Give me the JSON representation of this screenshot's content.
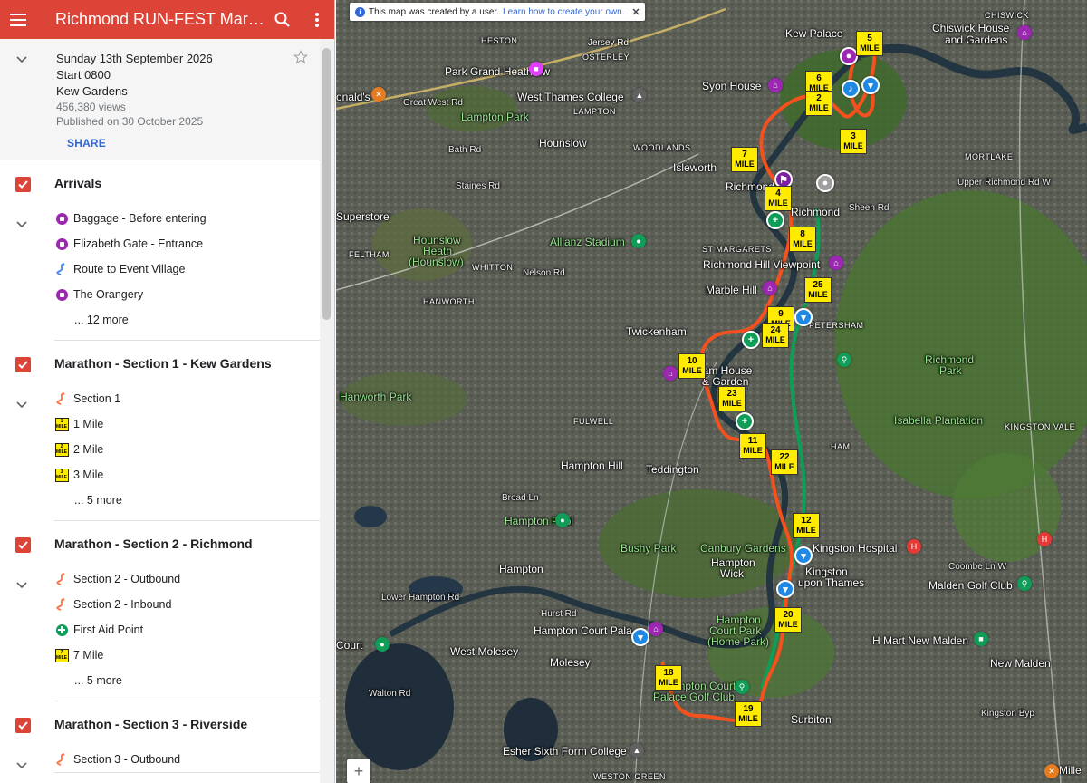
{
  "header": {
    "title": "Richmond RUN-FEST Marathon"
  },
  "info": {
    "date": "Sunday 13th September 2026",
    "start": "Start 0800",
    "venue": "Kew Gardens",
    "views": "456,380 views",
    "published": "Published on 30 October 2025",
    "share_label": "SHARE"
  },
  "layers": [
    {
      "title": "Arrivals",
      "items": [
        {
          "label": "Baggage - Before entering",
          "icon": "baggage-icon",
          "color": "#9c27b0"
        },
        {
          "label": "Elizabeth Gate - Entrance",
          "icon": "entrance-icon",
          "color": "#9c27b0"
        },
        {
          "label": "Route to Event Village",
          "icon": "route-icon",
          "color": "#4285f4"
        },
        {
          "label": "The Orangery",
          "icon": "cafe-icon",
          "color": "#9c27b0"
        }
      ],
      "more": "... 12 more"
    },
    {
      "title": "Marathon - Section 1 - Kew Gardens",
      "items": [
        {
          "label": "Section 1",
          "icon": "route-icon",
          "color": "#ff7043"
        },
        {
          "label": "1 Mile",
          "icon": "mile-marker-icon",
          "num": "1"
        },
        {
          "label": "2 Mile",
          "icon": "mile-marker-icon",
          "num": "2"
        },
        {
          "label": "3 Mile",
          "icon": "mile-marker-icon",
          "num": "3"
        }
      ],
      "more": "... 5 more"
    },
    {
      "title": "Marathon - Section 2 - Richmond",
      "items": [
        {
          "label": "Section 2 - Outbound",
          "icon": "route-icon",
          "color": "#ff7043"
        },
        {
          "label": "Section 2 - Inbound",
          "icon": "route-icon",
          "color": "#ff7043"
        },
        {
          "label": "First Aid Point",
          "icon": "first-aid-icon",
          "color": "#0f9d58"
        },
        {
          "label": "7 Mile",
          "icon": "mile-marker-icon",
          "num": "7"
        }
      ],
      "more": "... 5 more"
    },
    {
      "title": "Marathon - Section 3 - Riverside",
      "items": [
        {
          "label": "Section 3 - Outbound",
          "icon": "route-icon",
          "color": "#ff7043"
        }
      ],
      "more": ""
    }
  ],
  "map": {
    "notice_text": "This map was created by a user.",
    "notice_link": "Learn how to create your own.",
    "zoom_label": "+",
    "mile_word": "MILE",
    "route_color": "#f4511e",
    "labels": {
      "heston": "HESTON",
      "jersey_rd": "Jersey Rd",
      "osterley": "OSTERLEY",
      "kew_palace": "Kew Palace",
      "chiswick": "CHISWICK",
      "chiswick_house": "Chiswick House",
      "and_gardens": "and Gardens",
      "park_grand": "Park Grand Heathrow",
      "syon_house": "Syon House",
      "donalds": "onald's",
      "great_west_rd": "Great West Rd",
      "west_thames": "West Thames College",
      "lampton_park": "Lampton Park",
      "lampton": "LAMPTON",
      "hounslow": "Hounslow",
      "woodlands": "WOODLANDS",
      "mortlake": "MORTLAKE",
      "isleworth": "Isleworth",
      "bath_rd": "Bath Rd",
      "staines_rd": "Staines Rd",
      "richmond_small": "Richmond",
      "upper_richmond": "Upper Richmond Rd W",
      "superstore": "Superstore",
      "richmond": "Richmond",
      "sheen_rd": "Sheen Rd",
      "hounslow_heath": "Hounslow",
      "heath": "Heath",
      "hounslow_paren": "(Hounslow)",
      "allianz": "Allianz Stadium",
      "st_margarets": "ST MARGARETS",
      "feltham": "FELTHAM",
      "whitton": "WHITTON",
      "nelson_rd": "Nelson Rd",
      "richmond_hill": "Richmond Hill Viewpoint",
      "hanworth": "HANWORTH",
      "marble_hill": "Marble Hill",
      "twickenham": "Twickenham",
      "petersham": "PETERSHAM",
      "richmond_park": "Richmond",
      "park": "Park",
      "hanworth_park": "Hanworth Park",
      "ham_house": "Ham House",
      "and_garden": "& Garden",
      "fulwell": "FULWELL",
      "isabella": "Isabella Plantation",
      "kingston_vale": "KINGSTON VALE",
      "hampton_hill": "Hampton Hill",
      "teddington": "Teddington",
      "ham": "HAM",
      "hampton_pool": "Hampton Pool",
      "broad_ln": "Broad Ln",
      "bushy_park": "Bushy Park",
      "canbury": "Canbury Gardens",
      "kingston_hospital": "Kingston Hospital",
      "hampton": "Hampton",
      "hampton_wick": "Hampton",
      "wick": "Wick",
      "kingston": "Kingston",
      "upon_thames": "upon Thames",
      "malden_golf": "Malden Golf Club",
      "coombe_ln": "Coombe Ln W",
      "hampton_court_pal": "Hampton Court Pala",
      "hampton_court_park": "Hampton",
      "court_park": "Court Park",
      "home_park": "(Home Park)",
      "h_mart": "H Mart New Malden",
      "west_molesey": "West Molesey",
      "molesey": "Molesey",
      "new_malden": "New Malden",
      "court": "Court",
      "hampton_court_golf": "Hampton Court",
      "palace_golf": "Palace Golf Club",
      "surbiton": "Surbiton",
      "esher": "Esher Sixth Form College",
      "weston_green": "WESTON GREEN",
      "walton_rd": "Walton Rd",
      "hurst_rd": "Hurst Rd",
      "lower_hampton": "Lower Hampton Rd",
      "kingston_byp": "Kingston Byp",
      "mile_end": "Mille"
    },
    "miles": [
      {
        "n": "5"
      },
      {
        "n": "6"
      },
      {
        "n": "2"
      },
      {
        "n": "3"
      },
      {
        "n": "7"
      },
      {
        "n": "8"
      },
      {
        "n": "25"
      },
      {
        "n": "9"
      },
      {
        "n": "24"
      },
      {
        "n": "10"
      },
      {
        "n": "23"
      },
      {
        "n": "11"
      },
      {
        "n": "22"
      },
      {
        "n": "12"
      },
      {
        "n": "20"
      },
      {
        "n": "18"
      },
      {
        "n": "19"
      },
      {
        "n": "4"
      }
    ]
  }
}
